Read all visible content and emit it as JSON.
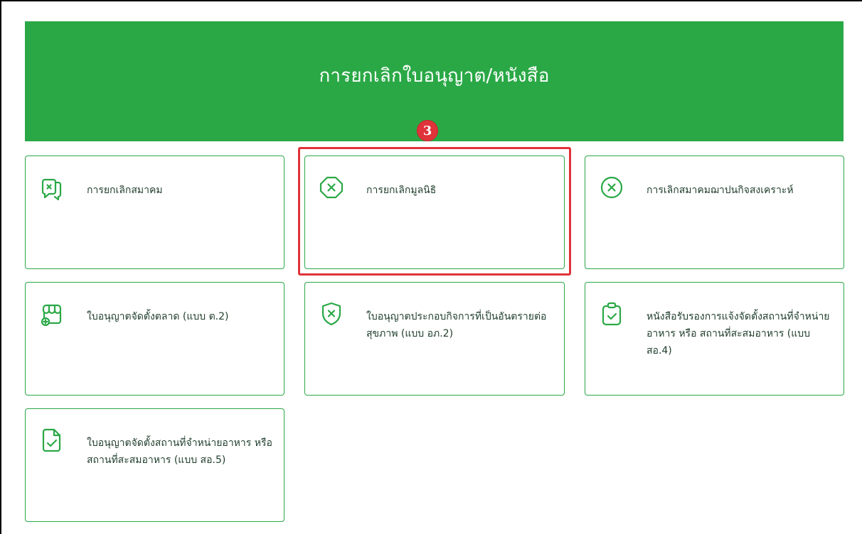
{
  "banner": {
    "title": "การยกเลิกใบอนุญาต/หนังสือ"
  },
  "step_badge": "3",
  "cards": [
    {
      "label": "การยกเลิกสมาคม",
      "icon": "cancel-chat-icon"
    },
    {
      "label": "การยกเลิกมูลนิธิ",
      "icon": "cancel-octagon-icon"
    },
    {
      "label": "การเลิกสมาคมฌาปนกิจสงเคราะห์",
      "icon": "cancel-circle-icon"
    },
    {
      "label": "ใบอนุญาตจัดตั้งตลาด (แบบ ต.2)",
      "icon": "market-add-icon"
    },
    {
      "label": "ใบอนุญาตประกอบกิจการที่เป็นอันตรายต่อสุขภาพ (แบบ อภ.2)",
      "icon": "shield-cancel-icon"
    },
    {
      "label": "หนังสือรับรองการแจ้งจัดตั้งสถานที่จำหน่ายอาหาร หรือ สถานที่สะสมอาหาร (แบบ สอ.4)",
      "icon": "clipboard-check-icon"
    },
    {
      "label": "ใบอนุญาตจัดตั้งสถานที่จำหน่ายอาหาร หรือสถานที่สะสมอาหาร (แบบ สอ.5)",
      "icon": "document-check-icon"
    }
  ],
  "colors": {
    "brand_green": "#2aa846",
    "highlight_red": "#e0333a"
  }
}
